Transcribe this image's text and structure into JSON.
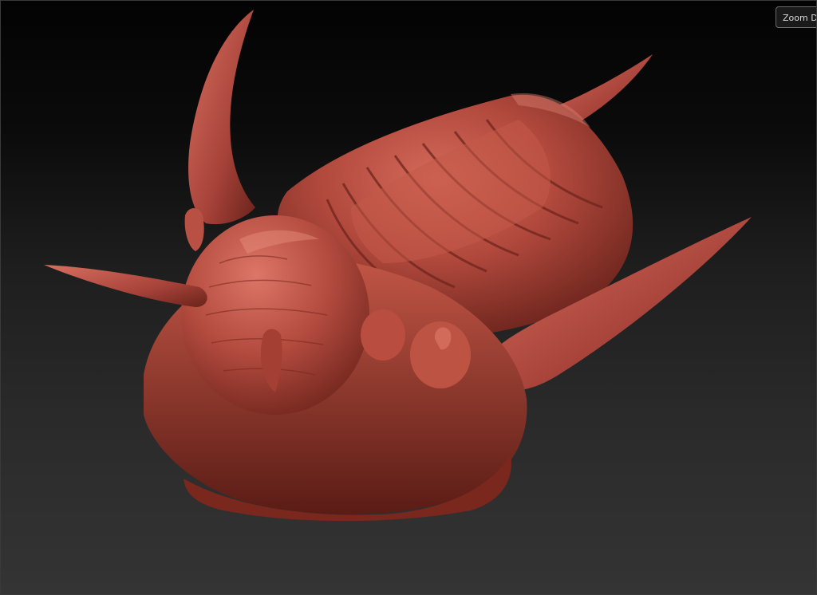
{
  "toolbar": {
    "zoom_label": "Zoom Do"
  },
  "model": {
    "color": "#b0483c",
    "object": "trilobite-sculpt"
  },
  "colors": {
    "background_top": "#030303",
    "background_bottom": "#343434",
    "button_border": "#6a6a6a",
    "button_text": "#dcdcdc"
  }
}
